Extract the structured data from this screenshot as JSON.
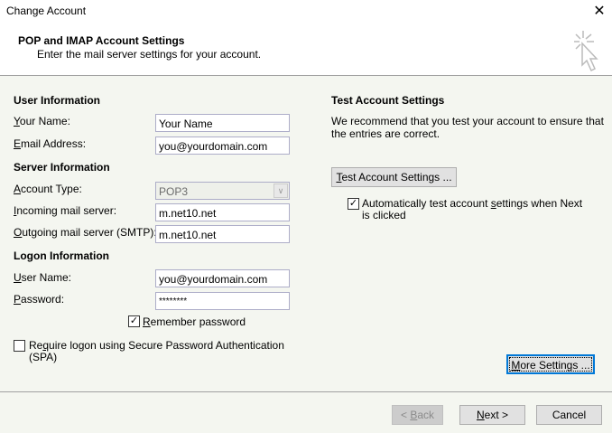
{
  "window": {
    "title": "Change Account"
  },
  "header": {
    "title": "POP and IMAP Account Settings",
    "subtitle": "Enter the mail server settings for your account."
  },
  "user_info": {
    "heading": "User Information",
    "name_label_u": "Y",
    "name_label": "our Name:",
    "name_value": "Your Name",
    "email_label_u": "E",
    "email_label": "mail Address:",
    "email_value": "you@yourdomain.com"
  },
  "server_info": {
    "heading": "Server Information",
    "type_label_u": "A",
    "type_label": "ccount Type:",
    "type_value": "POP3",
    "incoming_label_u": "I",
    "incoming_label": "ncoming mail server:",
    "incoming_value": "m.net10.net",
    "outgoing_label_u": "O",
    "outgoing_label": "utgoing mail server (SMTP):",
    "outgoing_value": "m.net10.net"
  },
  "logon_info": {
    "heading": "Logon Information",
    "user_label_u": "U",
    "user_label": "ser Name:",
    "user_value": "you@yourdomain.com",
    "password_label_u": "P",
    "password_label": "assword:",
    "password_value": "********",
    "remember_u": "R",
    "remember": "emember password",
    "remember_checked": true,
    "spa_pre": "Re",
    "spa_u": "q",
    "spa_post": "uire logon using Secure Password Authentication",
    "spa_line2": "(SPA)",
    "spa_checked": false
  },
  "test": {
    "heading": "Test Account Settings",
    "desc1": "We recommend that you test your account to ensure that",
    "desc2": "the entries are correct.",
    "button_u": "T",
    "button": "est Account Settings ...",
    "auto_pre": "Automatically test account ",
    "auto_u": "s",
    "auto_post": "ettings when Next",
    "auto_line2": "is clicked",
    "auto_checked": true
  },
  "buttons": {
    "more_u": "M",
    "more": "ore Settings ...",
    "back_pre": "< ",
    "back_u": "B",
    "back": "ack",
    "next_u": "N",
    "next": "ext >",
    "cancel": "Cancel"
  }
}
